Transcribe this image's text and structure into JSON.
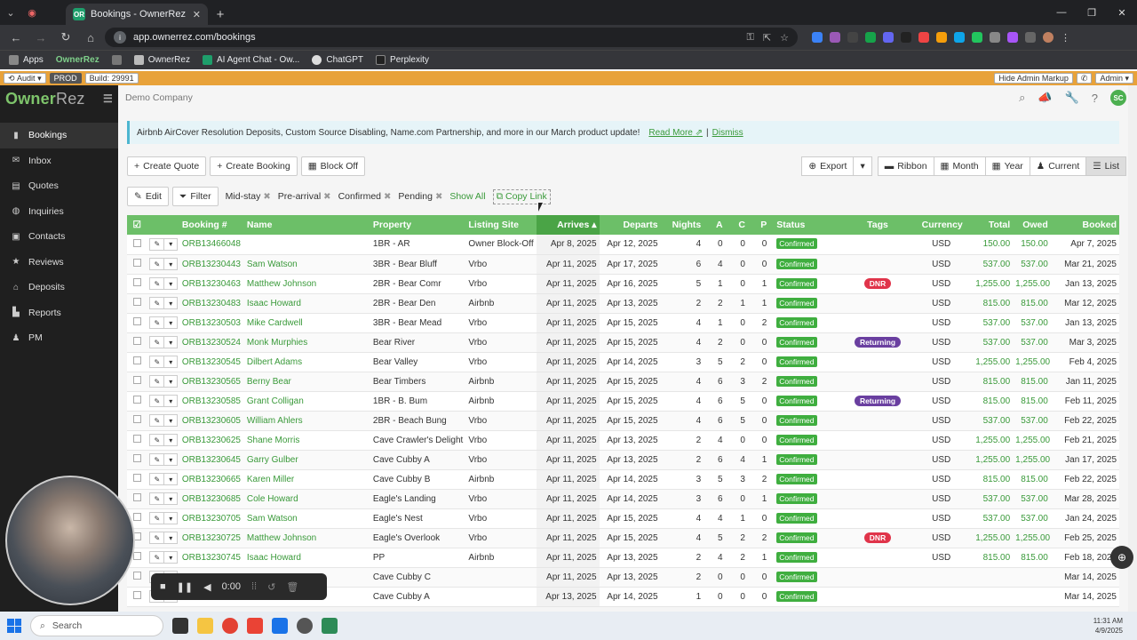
{
  "browser": {
    "tab_title": "Bookings - OwnerRez",
    "url": "app.ownerrez.com/bookings",
    "bookmarks": [
      "Apps",
      "OwnerRez",
      "OwnerRez",
      "AI Agent Chat - Ow...",
      "ChatGPT",
      "Perplexity"
    ]
  },
  "admin_bar": {
    "audit": "Audit",
    "env": "PROD",
    "build": "Build: 29991",
    "hide_markup": "Hide Admin Markup",
    "admin": "Admin"
  },
  "sidebar": {
    "logo_owner": "Owner",
    "logo_rez": "Rez",
    "items": [
      {
        "label": "Bookings",
        "icon": "book-icon"
      },
      {
        "label": "Inbox",
        "icon": "inbox-icon"
      },
      {
        "label": "Quotes",
        "icon": "document-icon"
      },
      {
        "label": "Inquiries",
        "icon": "globe-icon"
      },
      {
        "label": "Contacts",
        "icon": "contacts-icon"
      },
      {
        "label": "Reviews",
        "icon": "star-icon"
      },
      {
        "label": "Deposits",
        "icon": "bank-icon"
      },
      {
        "label": "Reports",
        "icon": "chart-icon"
      },
      {
        "label": "PM",
        "icon": "user-icon"
      }
    ]
  },
  "header": {
    "company": "Demo Company",
    "avatar": "SC"
  },
  "banner": {
    "text": "Airbnb AirCover Resolution Deposits, Custom Source Disabling, Name.com Partnership, and more in our March product update!",
    "read_more": "Read More",
    "sep": "|",
    "dismiss": "Dismiss"
  },
  "toolbar": {
    "create_quote": "Create Quote",
    "create_booking": "Create Booking",
    "block_off": "Block Off",
    "export": "Export",
    "ribbon": "Ribbon",
    "month": "Month",
    "year": "Year",
    "current": "Current",
    "list": "List"
  },
  "filters": {
    "edit": "Edit",
    "filter": "Filter",
    "chips": [
      "Mid-stay",
      "Pre-arrival",
      "Confirmed",
      "Pending"
    ],
    "show_all": "Show All",
    "copy_link": "Copy Link"
  },
  "table": {
    "headers": [
      "Booking #",
      "Name",
      "Property",
      "Listing Site",
      "Arrives",
      "Departs",
      "Nights",
      "A",
      "C",
      "P",
      "Status",
      "Tags",
      "Currency",
      "Total",
      "Owed",
      "Booked"
    ],
    "rows": [
      [
        "ORB13466048",
        "",
        "1BR - AR",
        "Owner Block-Off",
        "Apr 8, 2025",
        "Apr 12, 2025",
        "4",
        "0",
        "0",
        "0",
        "Confirmed",
        "",
        "USD",
        "150.00",
        "150.00",
        "Apr 7, 2025"
      ],
      [
        "ORB13230443",
        "Sam Watson",
        "3BR - Bear Bluff",
        "Vrbo",
        "Apr 11, 2025",
        "Apr 17, 2025",
        "6",
        "4",
        "0",
        "0",
        "Confirmed",
        "",
        "USD",
        "537.00",
        "537.00",
        "Mar 21, 2025"
      ],
      [
        "ORB13230463",
        "Matthew Johnson",
        "2BR - Bear Comr",
        "Vrbo",
        "Apr 11, 2025",
        "Apr 16, 2025",
        "5",
        "1",
        "0",
        "1",
        "Confirmed",
        "DNR",
        "USD",
        "1,255.00",
        "1,255.00",
        "Jan 13, 2025"
      ],
      [
        "ORB13230483",
        "Isaac Howard",
        "2BR - Bear Den",
        "Airbnb",
        "Apr 11, 2025",
        "Apr 13, 2025",
        "2",
        "2",
        "1",
        "1",
        "Confirmed",
        "",
        "USD",
        "815.00",
        "815.00",
        "Mar 12, 2025"
      ],
      [
        "ORB13230503",
        "Mike Cardwell",
        "3BR - Bear Mead",
        "Vrbo",
        "Apr 11, 2025",
        "Apr 15, 2025",
        "4",
        "1",
        "0",
        "2",
        "Confirmed",
        "",
        "USD",
        "537.00",
        "537.00",
        "Jan 13, 2025"
      ],
      [
        "ORB13230524",
        "Monk Murphies",
        "Bear River",
        "Vrbo",
        "Apr 11, 2025",
        "Apr 15, 2025",
        "4",
        "2",
        "0",
        "0",
        "Confirmed",
        "Returning",
        "USD",
        "537.00",
        "537.00",
        "Mar 3, 2025"
      ],
      [
        "ORB13230545",
        "Dilbert Adams",
        "Bear Valley",
        "Vrbo",
        "Apr 11, 2025",
        "Apr 14, 2025",
        "3",
        "5",
        "2",
        "0",
        "Confirmed",
        "",
        "USD",
        "1,255.00",
        "1,255.00",
        "Feb 4, 2025"
      ],
      [
        "ORB13230565",
        "Berny Bear",
        "Bear Timbers",
        "Airbnb",
        "Apr 11, 2025",
        "Apr 15, 2025",
        "4",
        "6",
        "3",
        "2",
        "Confirmed",
        "",
        "USD",
        "815.00",
        "815.00",
        "Jan 11, 2025"
      ],
      [
        "ORB13230585",
        "Grant Colligan",
        "1BR - B. Bum",
        "Airbnb",
        "Apr 11, 2025",
        "Apr 15, 2025",
        "4",
        "6",
        "5",
        "0",
        "Confirmed",
        "Returning",
        "USD",
        "815.00",
        "815.00",
        "Feb 11, 2025"
      ],
      [
        "ORB13230605",
        "William Ahlers",
        "2BR - Beach Bung",
        "Vrbo",
        "Apr 11, 2025",
        "Apr 15, 2025",
        "4",
        "6",
        "5",
        "0",
        "Confirmed",
        "",
        "USD",
        "537.00",
        "537.00",
        "Feb 22, 2025"
      ],
      [
        "ORB13230625",
        "Shane Morris",
        "Cave Crawler's Delight",
        "Vrbo",
        "Apr 11, 2025",
        "Apr 13, 2025",
        "2",
        "4",
        "0",
        "0",
        "Confirmed",
        "",
        "USD",
        "1,255.00",
        "1,255.00",
        "Feb 21, 2025"
      ],
      [
        "ORB13230645",
        "Garry Gulber",
        "Cave Cubby A",
        "Vrbo",
        "Apr 11, 2025",
        "Apr 13, 2025",
        "2",
        "6",
        "4",
        "1",
        "Confirmed",
        "",
        "USD",
        "1,255.00",
        "1,255.00",
        "Jan 17, 2025"
      ],
      [
        "ORB13230665",
        "Karen Miller",
        "Cave Cubby B",
        "Airbnb",
        "Apr 11, 2025",
        "Apr 14, 2025",
        "3",
        "5",
        "3",
        "2",
        "Confirmed",
        "",
        "USD",
        "815.00",
        "815.00",
        "Feb 22, 2025"
      ],
      [
        "ORB13230685",
        "Cole Howard",
        "Eagle's Landing",
        "Vrbo",
        "Apr 11, 2025",
        "Apr 14, 2025",
        "3",
        "6",
        "0",
        "1",
        "Confirmed",
        "",
        "USD",
        "537.00",
        "537.00",
        "Mar 28, 2025"
      ],
      [
        "ORB13230705",
        "Sam Watson",
        "Eagle's Nest",
        "Vrbo",
        "Apr 11, 2025",
        "Apr 15, 2025",
        "4",
        "4",
        "1",
        "0",
        "Confirmed",
        "",
        "USD",
        "537.00",
        "537.00",
        "Jan 24, 2025"
      ],
      [
        "ORB13230725",
        "Matthew Johnson",
        "Eagle's Overlook",
        "Vrbo",
        "Apr 11, 2025",
        "Apr 15, 2025",
        "4",
        "5",
        "2",
        "2",
        "Confirmed",
        "DNR",
        "USD",
        "1,255.00",
        "1,255.00",
        "Feb 25, 2025"
      ],
      [
        "ORB13230745",
        "Isaac Howard",
        "PP",
        "Airbnb",
        "Apr 11, 2025",
        "Apr 13, 2025",
        "2",
        "4",
        "2",
        "1",
        "Confirmed",
        "",
        "USD",
        "815.00",
        "815.00",
        "Feb 18, 2025"
      ],
      [
        "",
        "",
        "Cave Cubby C",
        "",
        "Apr 11, 2025",
        "Apr 13, 2025",
        "2",
        "0",
        "0",
        "0",
        "Confirmed",
        "",
        "",
        "",
        "",
        "Mar 14, 2025"
      ],
      [
        "",
        "",
        "Cave Cubby A",
        "",
        "Apr 13, 2025",
        "Apr 14, 2025",
        "1",
        "0",
        "0",
        "0",
        "Confirmed",
        "",
        "",
        "",
        "",
        "Mar 14, 2025"
      ]
    ]
  },
  "tag_colors": {
    "DNR": "#e0344a",
    "Returning": "#6a3fa0"
  },
  "recorder": {
    "time": "0:00"
  },
  "taskbar": {
    "search": "Search",
    "time": "11:31 AM",
    "date": "4/9/2025"
  }
}
